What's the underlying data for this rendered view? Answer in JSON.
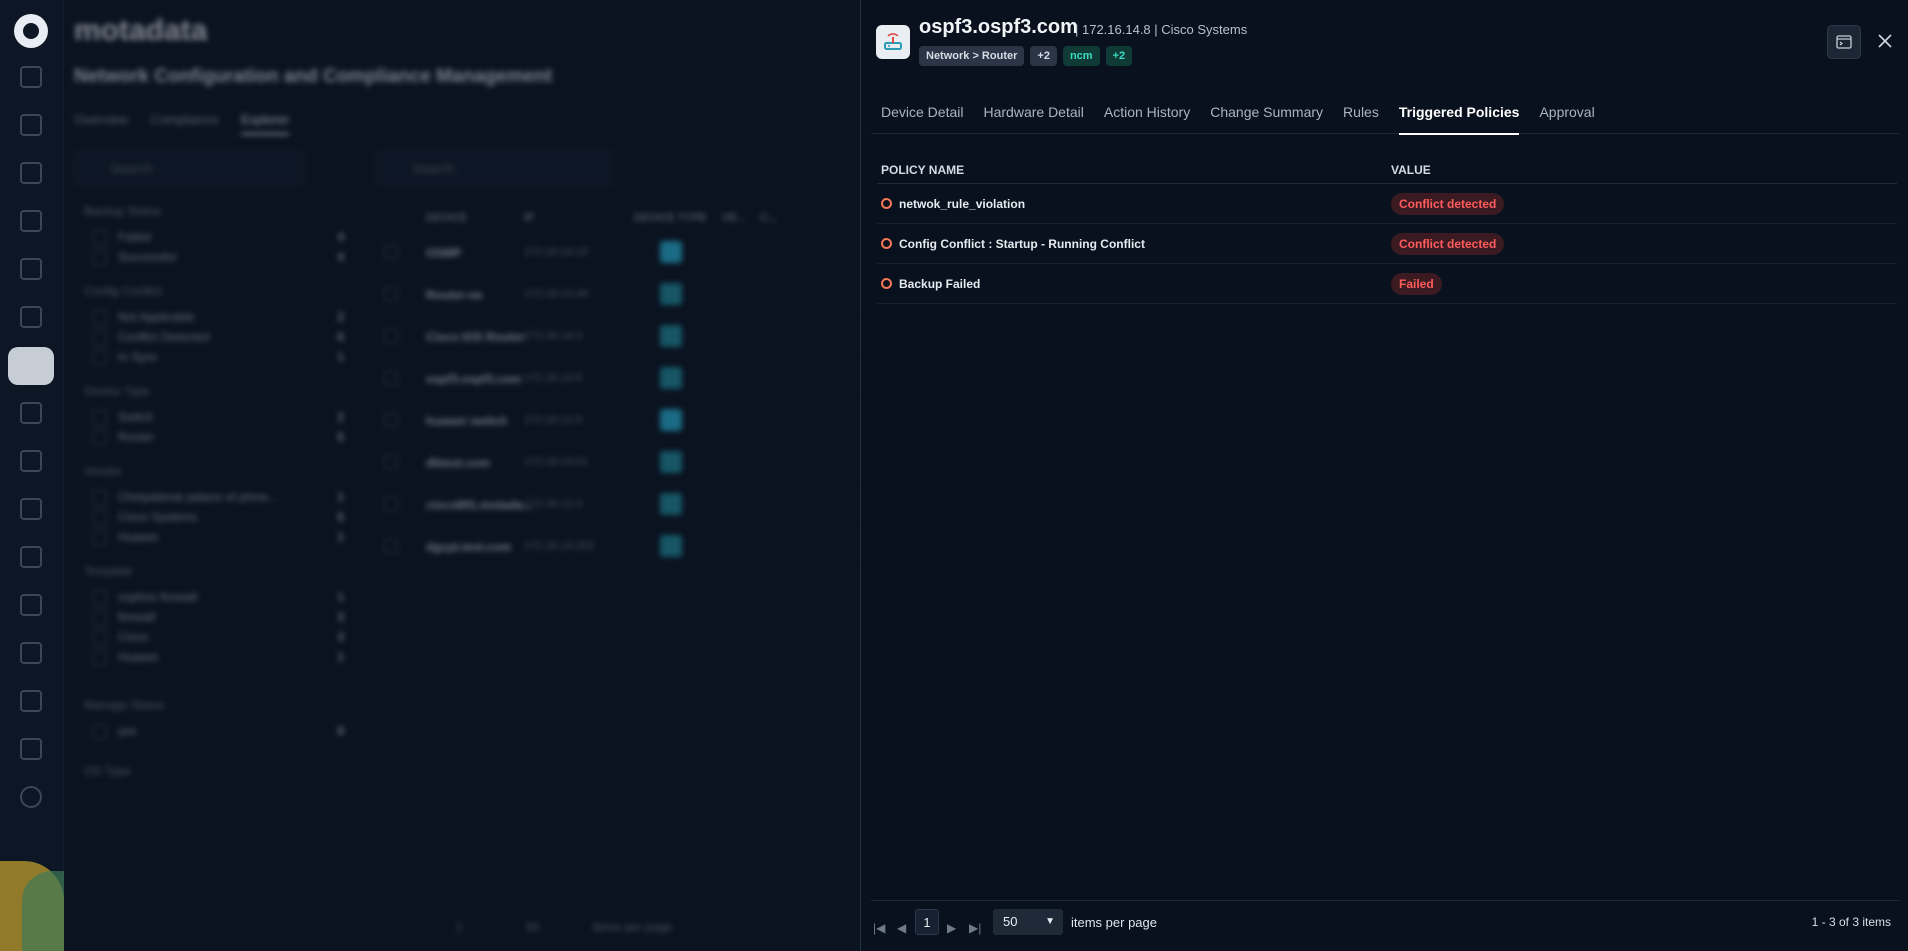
{
  "background": {
    "brand": "motadata",
    "page_title": "Network Configuration and Compliance Management",
    "tabs": [
      "Overview",
      "Compliance",
      "Explorer"
    ],
    "search_placeholder": "Search",
    "filter_groups": [
      {
        "title": "Backup Status",
        "items": [
          {
            "label": "Failed",
            "count": "4"
          },
          {
            "label": "Successful",
            "count": "4"
          }
        ]
      },
      {
        "title": "Config Conflict",
        "items": [
          {
            "label": "Not Applicable",
            "count": "2"
          },
          {
            "label": "Conflict Detected",
            "count": "6"
          },
          {
            "label": "In Sync",
            "count": "1"
          }
        ]
      },
      {
        "title": "Device Type",
        "items": [
          {
            "label": "Switch",
            "count": "2"
          },
          {
            "label": "Router",
            "count": "6"
          }
        ]
      },
      {
        "title": "Vendor",
        "items": [
          {
            "label": "Chelyabinsk palace of plone...",
            "count": "1"
          },
          {
            "label": "Cisco Systems",
            "count": "6"
          },
          {
            "label": "Huawei",
            "count": "1"
          }
        ]
      },
      {
        "title": "Template",
        "items": [
          {
            "label": "sophos firewall",
            "count": "1"
          },
          {
            "label": "firewall",
            "count": "3"
          },
          {
            "label": "Cisco",
            "count": "3"
          },
          {
            "label": "Huawei",
            "count": "1"
          }
        ]
      },
      {
        "title": "Manage Status",
        "items": [
          {
            "label": "yes",
            "count": "8"
          }
        ]
      },
      {
        "title": "OS Type",
        "items": []
      }
    ],
    "table_headers": [
      "DEVICE",
      "IP",
      "DEVICE TYPE",
      "VE...",
      "C..."
    ],
    "rows": [
      {
        "device": "OSMP",
        "ip": "172.16.14.15"
      },
      {
        "device": "Router-ne",
        "ip": "172.16.14.44"
      },
      {
        "device": "Cisco IOS Router",
        "ip": "172.16.14.3"
      },
      {
        "device": "ospf3.ospf3.com",
        "ip": "172.16.14.8"
      },
      {
        "device": "huawei switch",
        "ip": "172.16.12.5"
      },
      {
        "device": "dbtest.com",
        "ip": "172.16.14.51"
      },
      {
        "device": "cisco891.motada...",
        "ip": "172.16.12.3"
      },
      {
        "device": "dgcpt.test.com",
        "ip": "172.16.14.202"
      }
    ],
    "pager": {
      "page": "1",
      "per_page": "50",
      "label": "items per page"
    }
  },
  "drawer": {
    "device_name": "ospf3.ospf3.com",
    "device_meta": "| 172.16.14.8 | Cisco Systems",
    "tags": [
      {
        "label": "Network > Router",
        "style": "gray"
      },
      {
        "label": "+2",
        "style": "gray"
      },
      {
        "label": "ncm",
        "style": "teal"
      },
      {
        "label": "+2",
        "style": "teal"
      }
    ],
    "tabs": [
      {
        "label": "Device Detail",
        "active": false
      },
      {
        "label": "Hardware Detail",
        "active": false
      },
      {
        "label": "Action History",
        "active": false
      },
      {
        "label": "Change Summary",
        "active": false
      },
      {
        "label": "Rules",
        "active": false
      },
      {
        "label": "Triggered Policies",
        "active": true
      },
      {
        "label": "Approval",
        "active": false
      }
    ],
    "table": {
      "col_policy": "POLICY NAME",
      "col_value": "VALUE",
      "rows": [
        {
          "policy": "netwok_rule_violation",
          "value": "Conflict detected"
        },
        {
          "policy": "Config Conflict : Startup - Running Conflict",
          "value": "Conflict detected"
        },
        {
          "policy": "Backup Failed",
          "value": "Failed"
        }
      ]
    },
    "footer": {
      "page": "1",
      "per_page": "50",
      "per_page_label": "items per page",
      "count_text": "1 - 3 of 3 items"
    }
  },
  "colors": {
    "accent": "#ffffff",
    "status_danger": "#ff5c5c",
    "status_dot": "#f47a57",
    "teal": "#3fdcc1"
  },
  "icons": [
    "motadata-logo-icon",
    "router-icon",
    "terminal-icon",
    "close-icon",
    "first-page-icon",
    "prev-page-icon",
    "next-page-icon",
    "last-page-icon",
    "chevron-down-icon"
  ]
}
